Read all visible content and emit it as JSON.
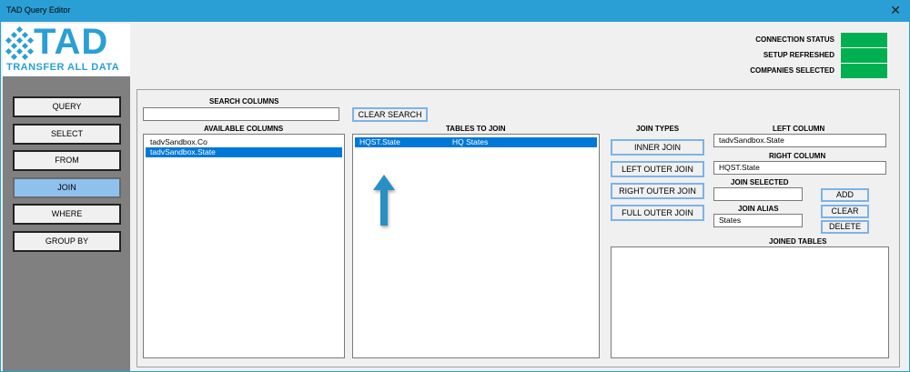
{
  "window": {
    "title": "TAD Query Editor",
    "close_glyph": "✕"
  },
  "logo": {
    "big": "TAD",
    "small": "TRANSFER ALL DATA"
  },
  "nav": [
    {
      "label": "QUERY",
      "active": false
    },
    {
      "label": "SELECT",
      "active": false
    },
    {
      "label": "FROM",
      "active": false
    },
    {
      "label": "JOIN",
      "active": true
    },
    {
      "label": "WHERE",
      "active": false
    },
    {
      "label": "GROUP BY",
      "active": false
    }
  ],
  "status": {
    "connection": "CONNECTION STATUS",
    "setup": "SETUP REFRESHED",
    "companies": "COMPANIES SELECTED",
    "color": "#00b050"
  },
  "search": {
    "label": "SEARCH COLUMNS",
    "value": "",
    "clear_label": "CLEAR SEARCH"
  },
  "available_columns": {
    "label": "AVAILABLE COLUMNS",
    "items": [
      {
        "text": "tadvSandbox.Co",
        "selected": false
      },
      {
        "text": "tadvSandbox.State",
        "selected": true
      }
    ]
  },
  "tables_to_join": {
    "label": "TABLES TO JOIN",
    "rows": [
      {
        "col1": "HQST.State",
        "col2": "HQ States",
        "selected": true
      }
    ]
  },
  "join_types": {
    "label": "JOIN TYPES",
    "inner": "INNER JOIN",
    "left_outer": "LEFT OUTER JOIN",
    "right_outer": "RIGHT OUTER JOIN",
    "full_outer": "FULL OUTER JOIN"
  },
  "left_column": {
    "label": "LEFT COLUMN",
    "value": "tadvSandbox.State"
  },
  "right_column": {
    "label": "RIGHT COLUMN",
    "value": "HQST.State"
  },
  "join_selected": {
    "label": "JOIN SELECTED",
    "value": ""
  },
  "join_alias": {
    "label": "JOIN ALIAS",
    "value": "States"
  },
  "actions": {
    "add": "ADD",
    "clear": "CLEAR",
    "delete": "DELETE"
  },
  "joined_tables": {
    "label": "JOINED TABLES"
  },
  "accent_colors": {
    "titlebar": "#2a9fd6",
    "selection": "#0078d7",
    "arrow": "#2a8fc4"
  }
}
